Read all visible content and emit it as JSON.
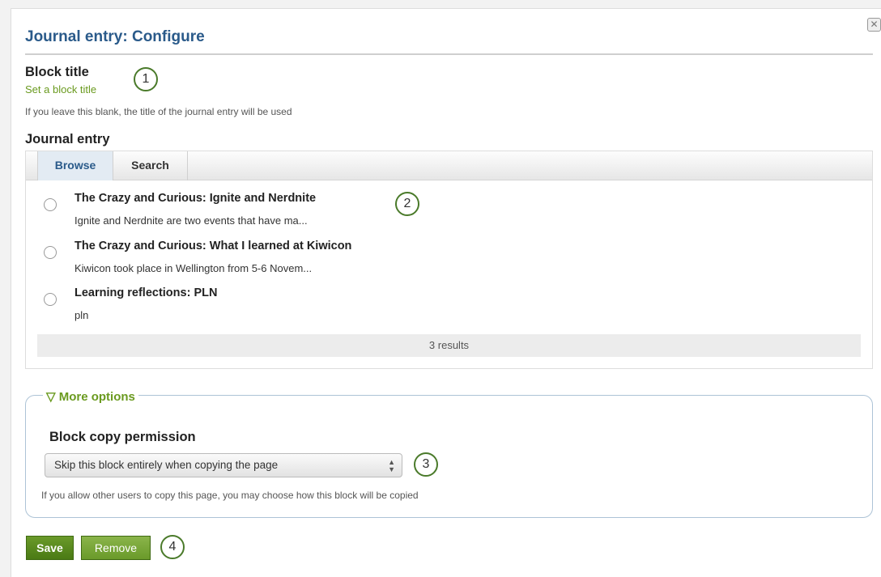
{
  "dialog": {
    "title": "Journal entry: Configure",
    "close_symbol": "✕"
  },
  "block_title": {
    "label": "Block title",
    "placeholder_link": "Set a block title",
    "hint": "If you leave this blank, the title of the journal entry will be used"
  },
  "journal_entry": {
    "label": "Journal entry",
    "tabs": [
      {
        "label": "Browse",
        "active": true
      },
      {
        "label": "Search",
        "active": false
      }
    ],
    "entries": [
      {
        "title": "The Crazy and Curious: Ignite and Nerdnite",
        "excerpt": "Ignite and Nerdnite are two events that have ma..."
      },
      {
        "title": "The Crazy and Curious: What I learned at Kiwicon",
        "excerpt": "Kiwicon took place in Wellington from 5-6 Novem..."
      },
      {
        "title": "Learning reflections: PLN",
        "excerpt": "pln"
      }
    ],
    "results": "3 results"
  },
  "more_options": {
    "legend": "▽ More options",
    "copy_permission_label": "Block copy permission",
    "copy_permission_value": "Skip this block entirely when copying the page",
    "copy_permission_hint": "If you allow other users to copy this page, you may choose how this block will be copied"
  },
  "actions": {
    "save_label": "Save",
    "remove_label": "Remove"
  },
  "callouts": [
    "1",
    "2",
    "3",
    "4"
  ],
  "colors": {
    "title_blue": "#2a5a8a",
    "link_green": "#6a9a1f",
    "button_green": "#5a8a1f",
    "callout_border": "#4a7a2a"
  },
  "icons": {
    "close": "close-icon",
    "radio": "radio-icon",
    "select_arrows": "select-arrows-icon"
  }
}
